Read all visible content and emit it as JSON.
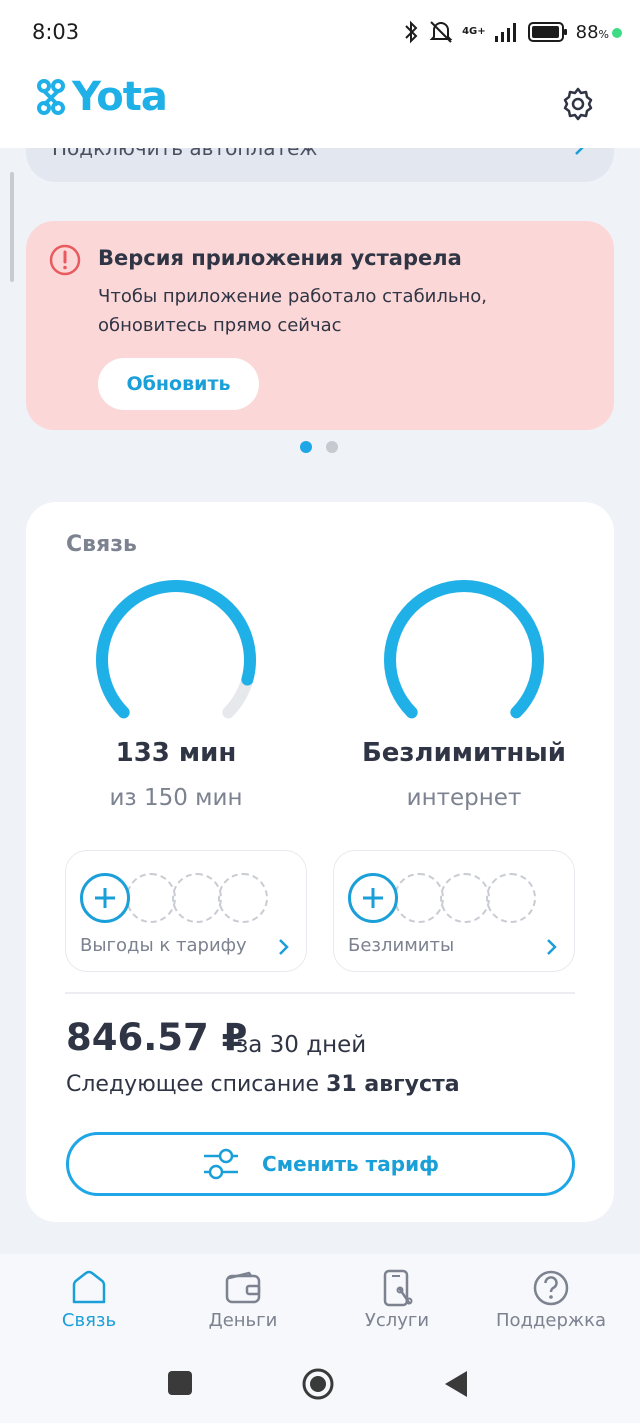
{
  "status_bar": {
    "time": "8:03",
    "network": "4G+",
    "battery_percent": "88",
    "battery_unit": "%"
  },
  "header": {
    "logo_text": "Yota",
    "settings_icon": "gear-icon"
  },
  "autopay": {
    "label": "Подключить автоплатеж"
  },
  "alert": {
    "title": "Версия приложения устарела",
    "text": "Чтобы приложение работало стабильно, обновитесь прямо сейчас",
    "button": "Обновить"
  },
  "pager": {
    "pages": 2,
    "active": 1
  },
  "connection": {
    "title": "Связь",
    "minutes": {
      "value": "133 мин",
      "sub": "из 150 мин",
      "used_fraction": 0.89
    },
    "internet": {
      "value": "Безлимитный",
      "sub": "интернет",
      "used_fraction": 1.0
    },
    "addons": [
      {
        "label": "Выгоды к тарифу"
      },
      {
        "label": "Безлимиты"
      }
    ],
    "price": "846.57 ₽",
    "period": "за 30 дней",
    "next_charge_label": "Следующее списание",
    "next_charge_date": "31 августа",
    "change_button": "Сменить тариф"
  },
  "bottom_nav": {
    "items": [
      {
        "label": "Связь",
        "icon": "home-icon",
        "active": true
      },
      {
        "label": "Деньги",
        "icon": "wallet-icon",
        "active": false
      },
      {
        "label": "Услуги",
        "icon": "services-icon",
        "active": false
      },
      {
        "label": "Поддержка",
        "icon": "help-icon",
        "active": false
      }
    ]
  },
  "colors": {
    "brand": "#1fb0e8",
    "accent": "#1a9fd8",
    "alert_bg": "#fcd7d8",
    "alert_icon": "#e85a5e"
  }
}
